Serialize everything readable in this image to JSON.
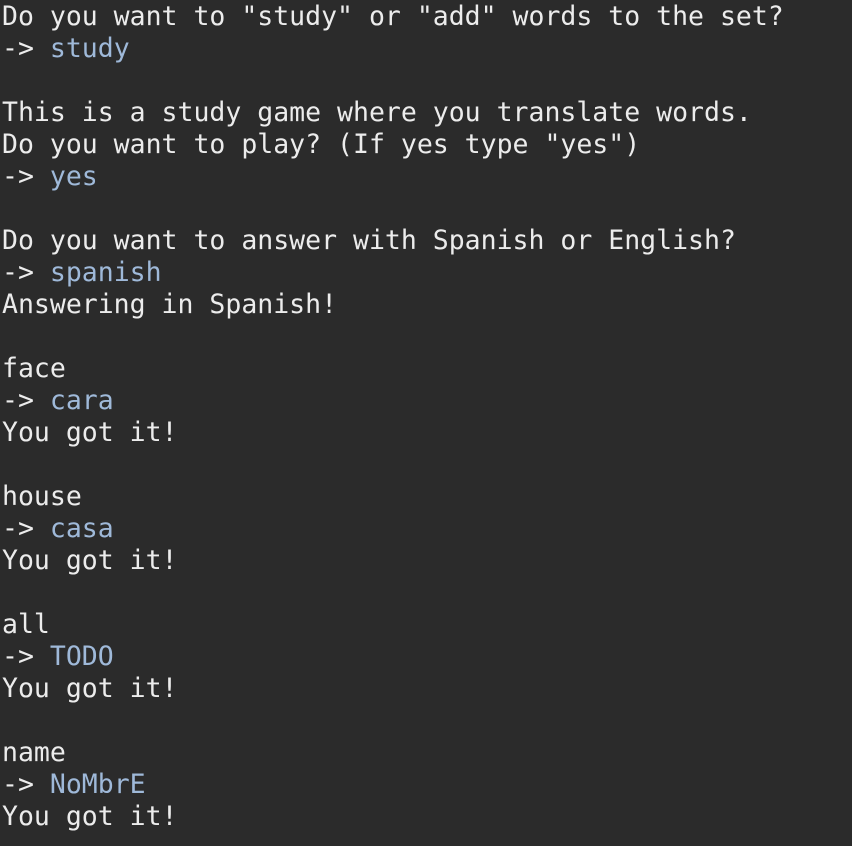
{
  "terminal": {
    "prompt": "-> ",
    "lines": [
      {
        "kind": "output",
        "text": "Do you want to \"study\" or \"add\" words to the set?"
      },
      {
        "kind": "input",
        "text": "study"
      },
      {
        "kind": "blank"
      },
      {
        "kind": "output",
        "text": "This is a study game where you translate words."
      },
      {
        "kind": "output",
        "text": "Do you want to play? (If yes type \"yes\")"
      },
      {
        "kind": "input",
        "text": "yes"
      },
      {
        "kind": "blank"
      },
      {
        "kind": "output",
        "text": "Do you want to answer with Spanish or English?"
      },
      {
        "kind": "input",
        "text": "spanish"
      },
      {
        "kind": "output",
        "text": "Answering in Spanish!"
      },
      {
        "kind": "blank"
      },
      {
        "kind": "output",
        "text": "face"
      },
      {
        "kind": "input",
        "text": "cara"
      },
      {
        "kind": "output",
        "text": "You got it!"
      },
      {
        "kind": "blank"
      },
      {
        "kind": "output",
        "text": "house"
      },
      {
        "kind": "input",
        "text": "casa"
      },
      {
        "kind": "output",
        "text": "You got it!"
      },
      {
        "kind": "blank"
      },
      {
        "kind": "output",
        "text": "all"
      },
      {
        "kind": "input",
        "text": "TODO"
      },
      {
        "kind": "output",
        "text": "You got it!"
      },
      {
        "kind": "blank"
      },
      {
        "kind": "output",
        "text": "name"
      },
      {
        "kind": "input",
        "text": "NoMbrE"
      },
      {
        "kind": "output",
        "text": "You got it!"
      }
    ]
  },
  "colors": {
    "background": "#2b2b2b",
    "output_text": "#ececec",
    "input_text": "#9fb9d9"
  }
}
